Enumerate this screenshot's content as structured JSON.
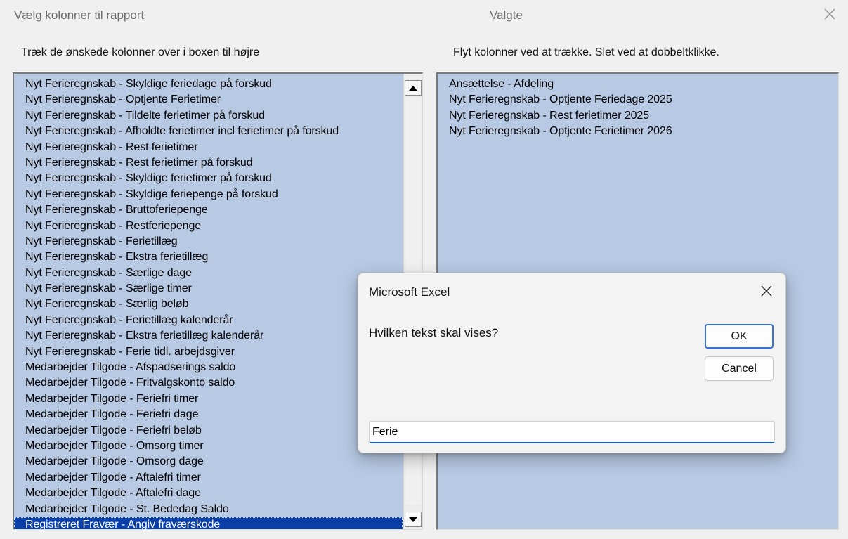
{
  "window": {
    "title": "Vælg kolonner til rapport",
    "selected_title": "Valgte"
  },
  "instructions": {
    "left": "Træk de ønskede kolonner over i boxen til højre",
    "right": "Flyt kolonner ved at trække. Slet ved at dobbeltklikke."
  },
  "available_columns": [
    "Nyt Ferieregnskab - Skyldige feriedage på forskud",
    "Nyt Ferieregnskab - Optjente Ferietimer",
    "Nyt Ferieregnskab - Tildelte ferietimer på forskud",
    "Nyt Ferieregnskab - Afholdte ferietimer incl ferietimer på forskud",
    "Nyt Ferieregnskab - Rest ferietimer",
    "Nyt Ferieregnskab - Rest ferietimer på forskud",
    "Nyt Ferieregnskab - Skyldige ferietimer på forskud",
    "Nyt Ferieregnskab - Skyldige feriepenge på forskud",
    "Nyt Ferieregnskab - Bruttoferiepenge",
    "Nyt Ferieregnskab - Restferiepenge",
    "Nyt Ferieregnskab - Ferietillæg",
    "Nyt Ferieregnskab - Ekstra ferietillæg",
    "Nyt Ferieregnskab - Særlige dage",
    "Nyt Ferieregnskab - Særlige timer",
    "Nyt Ferieregnskab - Særlig beløb",
    "Nyt Ferieregnskab - Ferietillæg kalenderår",
    "Nyt Ferieregnskab - Ekstra ferietillæg kalenderår",
    "Nyt Ferieregnskab - Ferie tidl. arbejdsgiver",
    "Medarbejder Tilgode - Afspadserings saldo",
    "Medarbejder Tilgode - Fritvalgskonto saldo",
    "Medarbejder Tilgode - Feriefri timer",
    "Medarbejder Tilgode - Feriefri dage",
    "Medarbejder Tilgode - Feriefri beløb",
    "Medarbejder Tilgode - Omsorg timer",
    "Medarbejder Tilgode - Omsorg dage",
    "Medarbejder Tilgode - Aftalefri timer",
    "Medarbejder Tilgode - Aftalefri dage",
    "Medarbejder Tilgode - St. Bededag Saldo",
    "Registreret Fravær - Angiv fraværskode"
  ],
  "selected_index": 28,
  "selected_columns": [
    "Ansættelse - Afdeling",
    "Nyt Ferieregnskab - Optjente Feriedage 2025",
    "Nyt Ferieregnskab - Rest ferietimer 2025",
    "Nyt Ferieregnskab - Optjente Ferietimer 2026"
  ],
  "dialog": {
    "title": "Microsoft Excel",
    "prompt": "Hvilken tekst skal vises?",
    "ok_label": "OK",
    "cancel_label": "Cancel",
    "input_value": "Ferie"
  },
  "colors": {
    "list_bg": "#b7c9e3",
    "selection": "#0a3fa8",
    "focus_accent": "#1661c8"
  }
}
